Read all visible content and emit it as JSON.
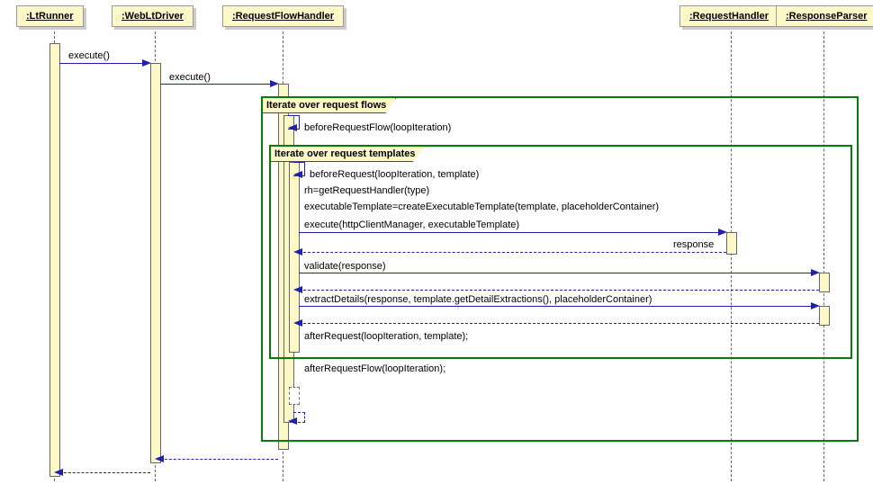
{
  "participants": {
    "p1": ":LtRunner",
    "p2": ":WebLtDriver",
    "p3": ":RequestFlowHandler",
    "p4": ":RequestHandler",
    "p5": ":ResponseParser"
  },
  "messages": {
    "m1": "execute()",
    "m2": "execute()",
    "m3": "beforeRequestFlow(loopIteration)",
    "m4": "beforeRequest(loopIteration, template)",
    "m5": "rh=getRequestHandler(type)",
    "m6": "executableTemplate=createExecutableTemplate(template, placeholderContainer)",
    "m7": "execute(httpClientManager, executableTemplate)",
    "m8": "response",
    "m9": "validate(response)",
    "m10": "extractDetails(response, template.getDetailExtractions(), placeholderContainer)",
    "m11": "afterRequest(loopIteration, template);",
    "m12": "afterRequestFlow(loopIteration);"
  },
  "fragments": {
    "f1": "Iterate over request flows",
    "f2": "Iterate over request templates"
  },
  "chart_data": {
    "type": "uml-sequence-diagram",
    "participants": [
      {
        "id": "LtRunner",
        "label": ":LtRunner"
      },
      {
        "id": "WebLtDriver",
        "label": ":WebLtDriver"
      },
      {
        "id": "RequestFlowHandler",
        "label": ":RequestFlowHandler"
      },
      {
        "id": "RequestHandler",
        "label": ":RequestHandler"
      },
      {
        "id": "ResponseParser",
        "label": ":ResponseParser"
      }
    ],
    "fragments": [
      {
        "type": "loop",
        "label": "Iterate over request flows",
        "contains": [
          "beforeRequestFlow",
          "inner-loop",
          "afterRequestFlow"
        ]
      },
      {
        "type": "loop",
        "label": "Iterate over request templates",
        "contains": [
          "beforeRequest",
          "getRequestHandler",
          "createExecutableTemplate",
          "execute-to-handler",
          "response",
          "validate",
          "extractDetails",
          "afterRequest"
        ]
      }
    ],
    "messages": [
      {
        "from": "LtRunner",
        "to": "WebLtDriver",
        "label": "execute()",
        "kind": "sync"
      },
      {
        "from": "WebLtDriver",
        "to": "RequestFlowHandler",
        "label": "execute()",
        "kind": "sync"
      },
      {
        "from": "RequestFlowHandler",
        "to": "RequestFlowHandler",
        "label": "beforeRequestFlow(loopIteration)",
        "kind": "self"
      },
      {
        "from": "RequestFlowHandler",
        "to": "RequestFlowHandler",
        "label": "beforeRequest(loopIteration, template)",
        "kind": "self"
      },
      {
        "from": "RequestFlowHandler",
        "to": "RequestFlowHandler",
        "label": "rh=getRequestHandler(type)",
        "kind": "self"
      },
      {
        "from": "RequestFlowHandler",
        "to": "RequestFlowHandler",
        "label": "executableTemplate=createExecutableTemplate(template, placeholderContainer)",
        "kind": "self"
      },
      {
        "from": "RequestFlowHandler",
        "to": "RequestHandler",
        "label": "execute(httpClientManager, executableTemplate)",
        "kind": "sync"
      },
      {
        "from": "RequestHandler",
        "to": "RequestFlowHandler",
        "label": "response",
        "kind": "return"
      },
      {
        "from": "RequestFlowHandler",
        "to": "ResponseParser",
        "label": "validate(response)",
        "kind": "sync"
      },
      {
        "from": "ResponseParser",
        "to": "RequestFlowHandler",
        "label": "",
        "kind": "return"
      },
      {
        "from": "RequestFlowHandler",
        "to": "ResponseParser",
        "label": "extractDetails(response, template.getDetailExtractions(), placeholderContainer)",
        "kind": "sync"
      },
      {
        "from": "ResponseParser",
        "to": "RequestFlowHandler",
        "label": "",
        "kind": "return"
      },
      {
        "from": "RequestFlowHandler",
        "to": "RequestFlowHandler",
        "label": "afterRequest(loopIteration, template);",
        "kind": "self"
      },
      {
        "from": "RequestFlowHandler",
        "to": "RequestFlowHandler",
        "label": "afterRequestFlow(loopIteration);",
        "kind": "self"
      },
      {
        "from": "RequestFlowHandler",
        "to": "RequestFlowHandler",
        "label": "",
        "kind": "self-return"
      },
      {
        "from": "RequestFlowHandler",
        "to": "WebLtDriver",
        "label": "",
        "kind": "return"
      },
      {
        "from": "WebLtDriver",
        "to": "LtRunner",
        "label": "",
        "kind": "return"
      }
    ]
  }
}
